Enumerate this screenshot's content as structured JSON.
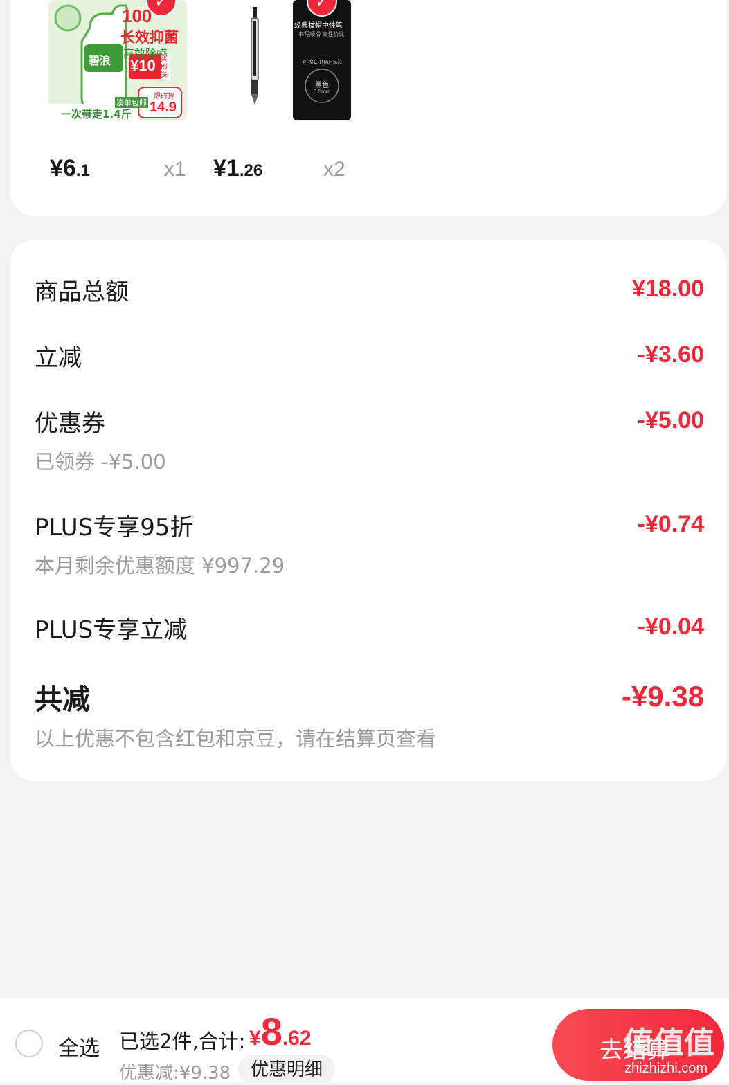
{
  "products": [
    {
      "price_main": "¥6",
      "price_decimal": ".1",
      "qty": "x1",
      "image_texts": {
        "headline_top": "100",
        "headline": "长效抑菌",
        "sub": "高效除螨",
        "brand": "碧浪",
        "promo_price": "¥10",
        "promo_tag": "买即送",
        "free_ship": "凑单包邮",
        "bottom_line": "一次带走1.4斤",
        "flash": "限时抢",
        "flash_price": "14.9"
      }
    },
    {
      "price_main": "¥1",
      "price_decimal": ".26",
      "qty": "x2",
      "image_texts": {
        "title": "经典拔帽中性笔",
        "subtitle": "书写顺滑 高性价比",
        "refill": "可换C-RJAH5芯",
        "color": "黑色",
        "size": "0.5mm"
      }
    }
  ],
  "summary": {
    "goods_total_label": "商品总额",
    "goods_total_value": "¥18.00",
    "instant_label": "立减",
    "instant_value": "-¥3.60",
    "coupon_label": "优惠券",
    "coupon_value": "-¥5.00",
    "coupon_sub": "已领券 -¥5.00",
    "plus95_label": "PLUS专享95折",
    "plus95_value": "-¥0.74",
    "plus95_sub": "本月剩余优惠额度 ¥997.29",
    "plus_instant_label": "PLUS专享立减",
    "plus_instant_value": "-¥0.04",
    "total_label": "共减",
    "total_value": "-¥9.38",
    "note": "以上优惠不包含红包和京豆，请在结算页查看"
  },
  "bottom_bar": {
    "select_all": "全选",
    "selected_text": "已选2件,合计:",
    "sum_yen": "¥",
    "sum_int": "8",
    "sum_dec": ".62",
    "discount_text": "优惠减:¥9.38",
    "detail_button": "优惠明细",
    "checkout_button": "去结算"
  },
  "watermark": {
    "text": "值值值",
    "url": "zhizhizhi.com"
  },
  "colors": {
    "accent_red": "#f0293a",
    "muted_gray": "#9a9a9a",
    "background": "#f3f3f3"
  }
}
